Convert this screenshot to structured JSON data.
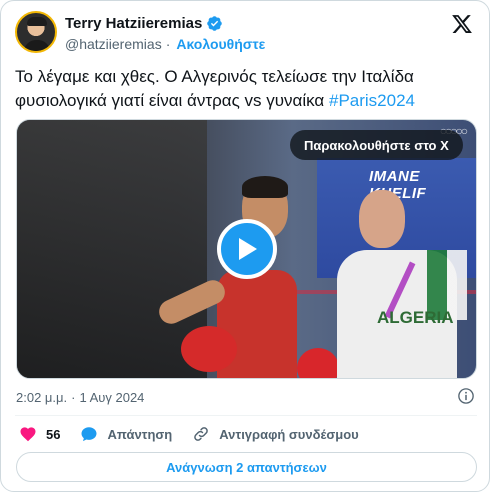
{
  "author": {
    "name": "Terry Hatziieremias",
    "handle": "@hatziieremias",
    "separator": "·",
    "follow_label": "Ακολουθήστε"
  },
  "tweet": {
    "text": "Το λέγαμε και χθες. Ο Αλγερινός τελείωσε την Ιταλίδα φυσιολογικά γιατί είναι άντρας vs γυναίκα",
    "hashtag": "#Paris2024"
  },
  "media": {
    "watch_label": "Παρακολουθήστε στο X",
    "banner_text": "IMANE KHELIF",
    "coach_label": "ALGERIA"
  },
  "meta": {
    "time": "2:02 μ.μ.",
    "separator": "·",
    "date": "1 Αυγ 2024"
  },
  "actions": {
    "likes": "56",
    "reply_label": "Απάντηση",
    "copy_link_label": "Αντιγραφή συνδέσμου"
  },
  "read_replies_label": "Ανάγνωση 2 απαντήσεων",
  "colors": {
    "accent": "#1d9bf0",
    "like": "#f91880",
    "text": "#0f1419",
    "muted": "#536471"
  }
}
